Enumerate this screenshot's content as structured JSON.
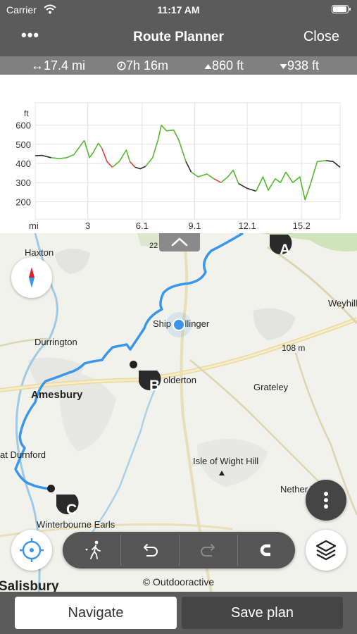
{
  "status_bar": {
    "carrier": "Carrier",
    "time": "11:17 AM",
    "battery_level": 1.0
  },
  "nav": {
    "title": "Route Planner",
    "more_label": "•••",
    "close_label": "Close"
  },
  "stats": {
    "distance": "↔17.4 mi",
    "duration": "7h 16m",
    "ascent": "860 ft",
    "descent": "938 ft"
  },
  "chart_data": {
    "type": "line",
    "ylabel": "ft",
    "xlabel": "mi",
    "ylim": [
      150,
      650
    ],
    "xlim": [
      0,
      17.4
    ],
    "y_ticks": [
      "600",
      "500",
      "400",
      "300",
      "200"
    ],
    "y_tick_values": [
      600,
      500,
      400,
      300,
      200
    ],
    "x_ticks": [
      "3",
      "6.1",
      "9.1",
      "12.1",
      "15.2"
    ],
    "x_tick_values": [
      3,
      6.1,
      9.1,
      12.1,
      15.2
    ],
    "grid": true,
    "colors": {
      "flat": "#2b2b2b",
      "up": "#56b830",
      "down": "#e04040"
    },
    "segments": [
      {
        "kind": "flat",
        "x": [
          0,
          0.4,
          0.9
        ],
        "y": [
          440,
          442,
          430
        ]
      },
      {
        "kind": "up",
        "x": [
          0.9,
          1.4,
          1.8,
          2.2,
          2.4,
          2.8
        ],
        "y": [
          430,
          425,
          430,
          445,
          470,
          520
        ]
      },
      {
        "kind": "up",
        "x": [
          2.8,
          3.1,
          3.3,
          3.6,
          3.8
        ],
        "y": [
          520,
          430,
          455,
          505,
          480
        ]
      },
      {
        "kind": "down",
        "x": [
          3.8,
          4.1,
          4.4
        ],
        "y": [
          480,
          410,
          380
        ]
      },
      {
        "kind": "up",
        "x": [
          4.4,
          4.8,
          5.2,
          5.4
        ],
        "y": [
          380,
          410,
          470,
          410
        ]
      },
      {
        "kind": "down",
        "x": [
          5.4,
          5.7
        ],
        "y": [
          410,
          380
        ]
      },
      {
        "kind": "flat",
        "x": [
          5.7,
          6.0,
          6.3
        ],
        "y": [
          380,
          372,
          385
        ]
      },
      {
        "kind": "up",
        "x": [
          6.3,
          6.7,
          7.0,
          7.2,
          7.5,
          7.9,
          8.2,
          8.6
        ],
        "y": [
          385,
          430,
          520,
          600,
          570,
          575,
          520,
          410
        ]
      },
      {
        "kind": "flat",
        "x": [
          8.6,
          8.9
        ],
        "y": [
          410,
          355
        ]
      },
      {
        "kind": "up",
        "x": [
          8.9,
          9.3,
          9.8,
          10.2
        ],
        "y": [
          355,
          330,
          345,
          320
        ]
      },
      {
        "kind": "down",
        "x": [
          10.2,
          10.6
        ],
        "y": [
          320,
          300
        ]
      },
      {
        "kind": "up",
        "x": [
          10.6,
          11.0,
          11.3,
          11.6
        ],
        "y": [
          300,
          330,
          365,
          295
        ]
      },
      {
        "kind": "flat",
        "x": [
          11.6,
          12.1,
          12.6
        ],
        "y": [
          295,
          270,
          255
        ]
      },
      {
        "kind": "up",
        "x": [
          12.6,
          13.0,
          13.3,
          13.7,
          14.0,
          14.3
        ],
        "y": [
          255,
          330,
          260,
          320,
          300,
          355
        ]
      },
      {
        "kind": "up",
        "x": [
          14.3,
          14.7,
          15.1,
          15.4,
          15.7,
          16.1
        ],
        "y": [
          355,
          300,
          330,
          210,
          290,
          410
        ]
      },
      {
        "kind": "up",
        "x": [
          16.1,
          16.6
        ],
        "y": [
          410,
          415
        ]
      },
      {
        "kind": "flat",
        "x": [
          16.6,
          17.0,
          17.4
        ],
        "y": [
          415,
          410,
          380
        ]
      }
    ]
  },
  "map": {
    "places": {
      "haxton": "Haxton",
      "durrington": "Durrington",
      "amesbury": "Amesbury",
      "durnford": "at Durnford",
      "winterbourne": "Winterbourne Earls",
      "salisbury": "Salisbury",
      "shipton": "Ship     Bellinger",
      "cholderton": "olderton",
      "grateley": "Grateley",
      "isle_of_wight": "Isle of Wight Hill",
      "nether": "Nether W",
      "weyhill": "Weyhill",
      "road_22": "22",
      "elevation_108": "108 m"
    },
    "waypoints": {
      "a": "A",
      "b": "B",
      "c": "C"
    },
    "copyright": "© Outdooractive"
  },
  "bottom": {
    "navigate_label": "Navigate",
    "save_label": "Save plan"
  }
}
